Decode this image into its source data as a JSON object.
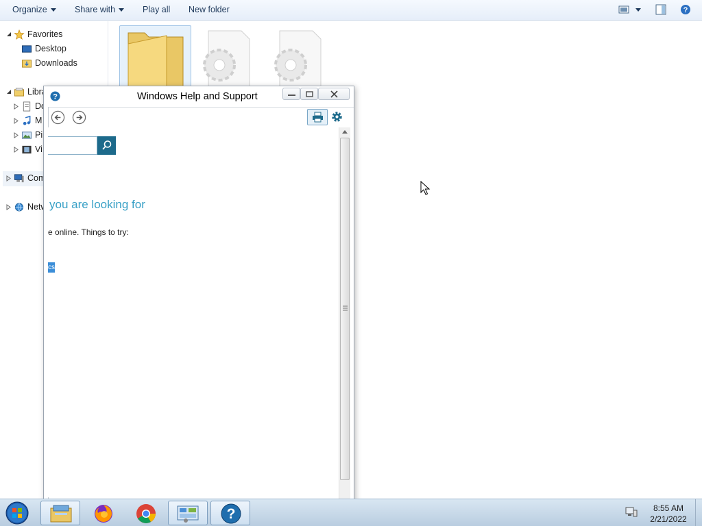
{
  "explorer": {
    "toolbar": {
      "organize": "Organize",
      "share_with": "Share with",
      "play_all": "Play all",
      "new_folder": "New folder"
    },
    "nav": {
      "favorites": "Favorites",
      "desktop": "Desktop",
      "downloads": "Downloads",
      "libraries": "Libra",
      "documents": "Do",
      "music": "M",
      "pictures": "Pi",
      "videos": "Vi",
      "computer": "Comp",
      "network": "Netw"
    }
  },
  "help": {
    "title": "Windows Help and Support",
    "heading": "you are looking for",
    "try_line": "e online. Things to try:",
    "link_fragment": "cs"
  },
  "taskbar": {
    "time": "8:55 AM",
    "date": "2/21/2022"
  },
  "colors": {
    "help_heading": "#38a0c6",
    "search_button": "#1d6a8b",
    "explorer_text": "#1e395b"
  }
}
